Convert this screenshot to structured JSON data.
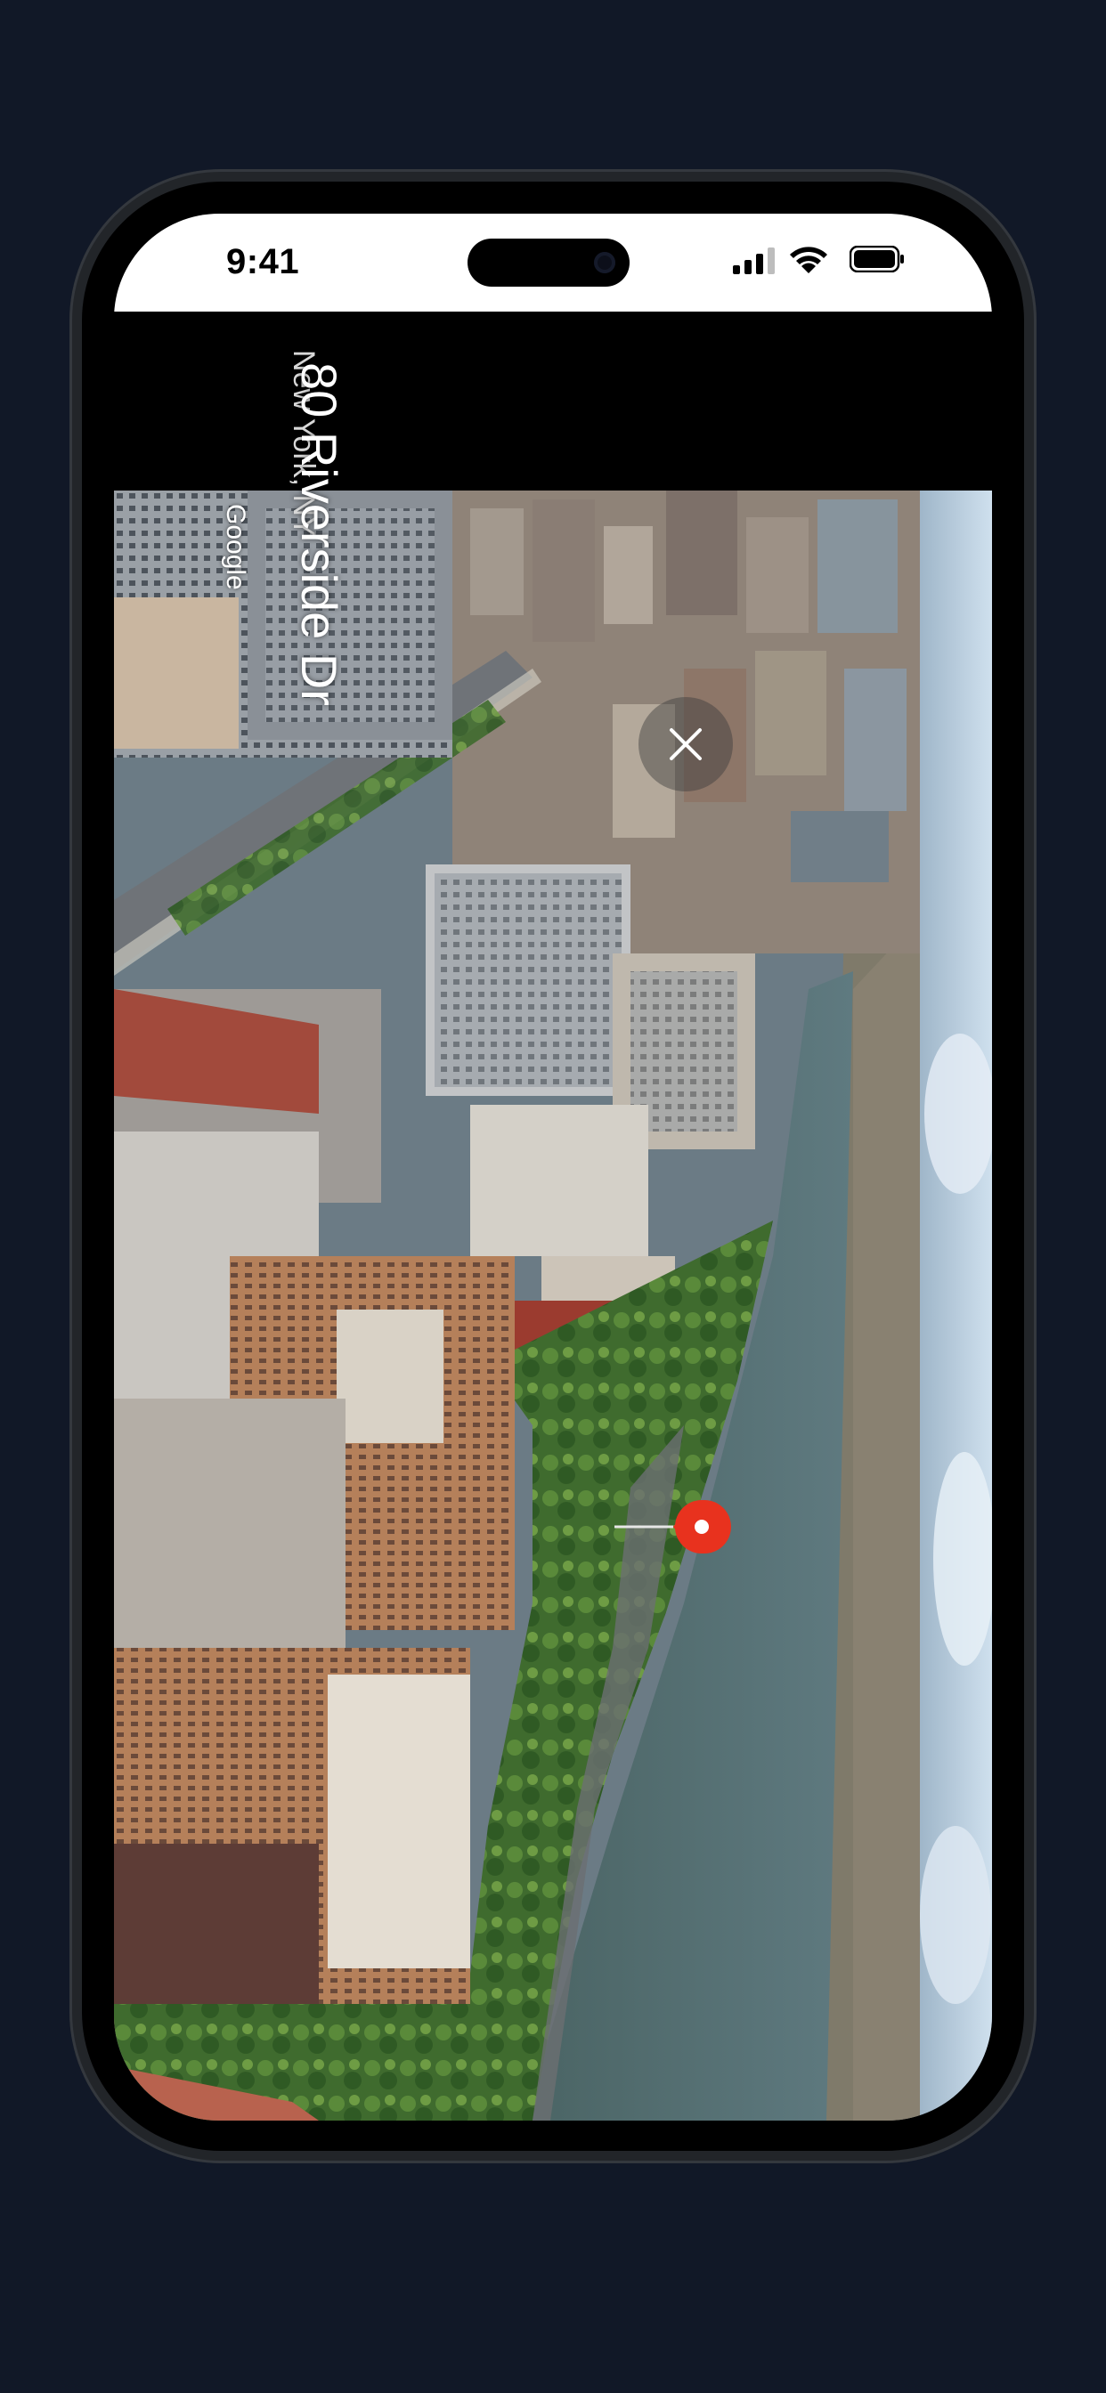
{
  "status_bar": {
    "time": "9:41",
    "signal_icon": "cellular-signal-icon",
    "wifi_icon": "wifi-icon",
    "battery_icon": "battery-icon"
  },
  "place": {
    "title": "80 Riverside Dr",
    "subtitle": "New York, NY"
  },
  "map": {
    "attribution": "Google",
    "close_icon": "close-icon",
    "pin_icon": "location-pin-icon",
    "pin_color": "#e8321e"
  },
  "colors": {
    "page_background": "#111827",
    "phone_frame": "#222529",
    "river": "#4f6b6e",
    "sky": "#b8cfe3"
  }
}
